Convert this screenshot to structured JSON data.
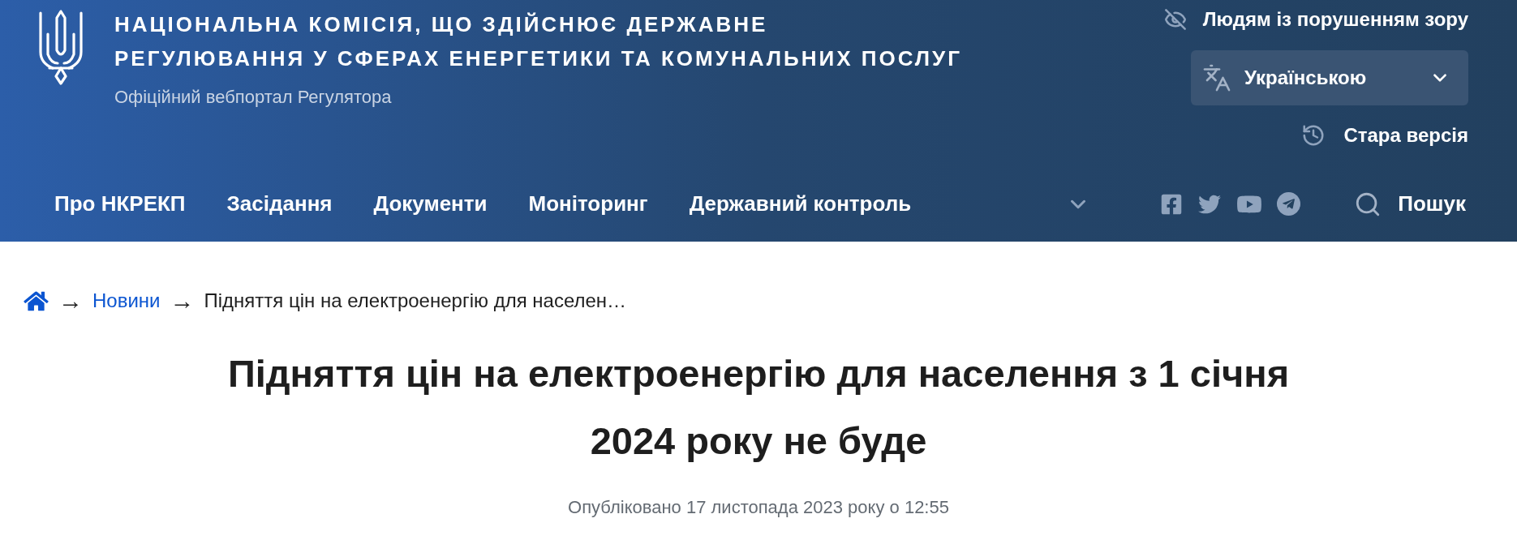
{
  "header": {
    "title": "НАЦІОНАЛЬНА КОМІСІЯ, ЩО ЗДІЙСНЮЄ ДЕРЖАВНЕ\nРЕГУЛЮВАННЯ У СФЕРАХ ЕНЕРГЕТИКИ ТА КОМУНАЛЬНИХ ПОСЛУГ",
    "subtitle": "Офіційний вебпортал Регулятора",
    "accessibility_link": "Людям із порушенням зору",
    "language_select": {
      "value": "Українською"
    },
    "old_version_link": "Стара версія"
  },
  "nav": {
    "items": [
      {
        "label": "Про НКРЕКП"
      },
      {
        "label": "Засідання"
      },
      {
        "label": "Документи"
      },
      {
        "label": "Моніторинг"
      },
      {
        "label": "Державний контроль"
      }
    ],
    "search": "Пошук"
  },
  "breadcrumb": {
    "items": [
      {
        "kind": "link",
        "separator": "→",
        "label": "Новини"
      },
      {
        "kind": "current",
        "separator": "→",
        "label": "Підняття цін на електроенергію для населен…"
      }
    ]
  },
  "article": {
    "title": "Підняття цін на електроенергію для населення з 1 січня 2024 року не буде",
    "published": "Опубліковано 17 листопада 2023 року о 12:55"
  }
}
